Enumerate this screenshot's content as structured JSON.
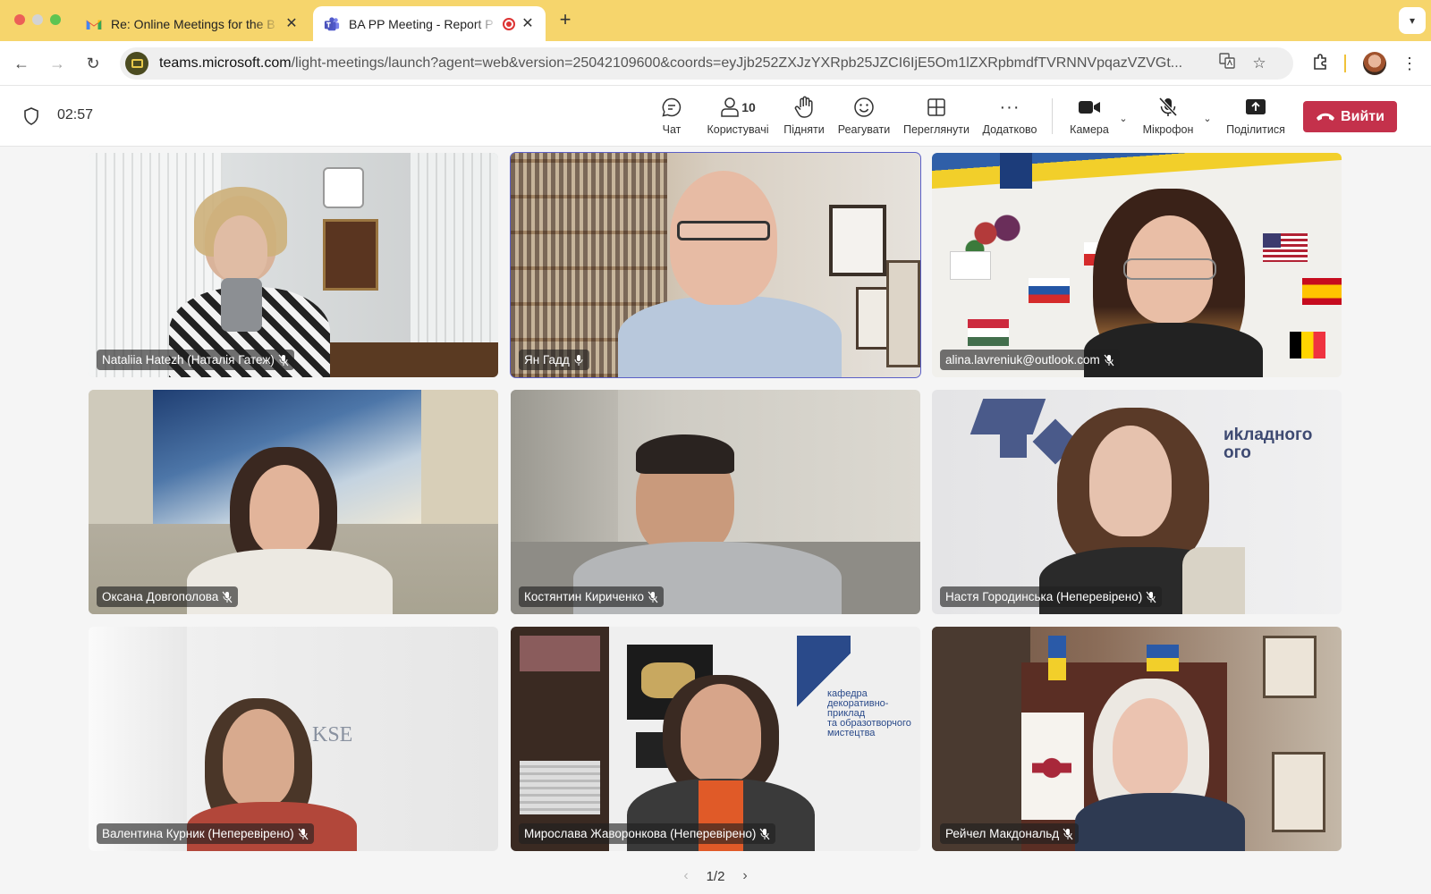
{
  "browser": {
    "tabs": [
      {
        "title": "Re: Online Meetings for the B",
        "favicon": "gmail-icon",
        "active": false
      },
      {
        "title": "BA PP Meeting - Report P",
        "favicon": "teams-icon",
        "active": true,
        "recording": true
      }
    ],
    "url_host": "teams.microsoft.com",
    "url_path": "/light-meetings/launch?agent=web&version=25042109600&coords=eyJjb252ZXJzYXRpb25JZCI6IjE5Om1lZXRpbmdfTVRNNVpqazVZVGt..."
  },
  "meeting": {
    "timer": "02:57",
    "controls": {
      "chat": "Чат",
      "people": "Користувачі",
      "people_count": "10",
      "raise": "Підняти",
      "react": "Реагувати",
      "view": "Переглянути",
      "more": "Додатково",
      "camera": "Камера",
      "mic": "Мікрофон",
      "share": "Поділитися",
      "leave": "Вийти"
    },
    "participants": [
      {
        "name": "Nataliia Hatezh (Наталія Гатеж)",
        "muted": true
      },
      {
        "name": "Ян Гадд",
        "muted": false,
        "speaking": true
      },
      {
        "name": "alina.lavreniuk@outlook.com",
        "muted": true
      },
      {
        "name": "Оксана Довгополова",
        "muted": true
      },
      {
        "name": "Костянтин Кириченко",
        "muted": true
      },
      {
        "name": "Настя Городинська (Неперевірено)",
        "muted": true
      },
      {
        "name": "Валентина Курник (Неперевірено)",
        "muted": true
      },
      {
        "name": "Мирослава Жаворонкова (Неперевірено)",
        "muted": true
      },
      {
        "name": "Рейчел Макдональд",
        "muted": true
      }
    ],
    "pager": "1/2"
  }
}
